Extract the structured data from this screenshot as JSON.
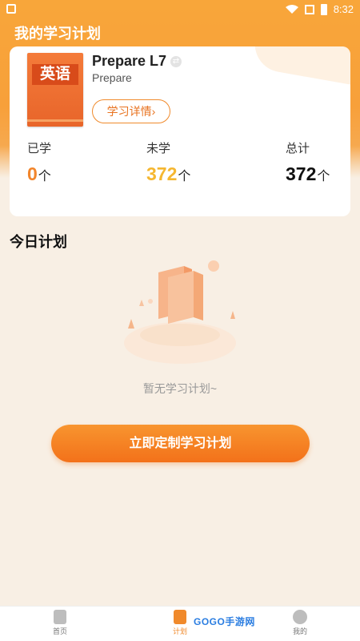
{
  "status": {
    "time": "8:32"
  },
  "header": {
    "title": "我的学习计划"
  },
  "book": {
    "cover_label": "英语",
    "title": "Prepare L7",
    "subtitle": "Prepare",
    "detail_button": "学习详情›"
  },
  "stats": [
    {
      "label": "已学",
      "value": "0",
      "unit": "个"
    },
    {
      "label": "未学",
      "value": "372",
      "unit": "个"
    },
    {
      "label": "总计",
      "value": "372",
      "unit": "个"
    }
  ],
  "today": {
    "title": "今日计划",
    "empty_text": "暂无学习计划~",
    "cta": "立即定制学习计划"
  },
  "tabs": [
    {
      "label": "首页",
      "icon": "home-book-icon"
    },
    {
      "label": "计划",
      "icon": "clock-icon"
    },
    {
      "label": "我的",
      "icon": "profile-icon"
    }
  ],
  "watermark": "GOGO手游网",
  "colors": {
    "accent": "#f08a2c",
    "learned": "#f2852b",
    "unlearned": "#f5b731"
  }
}
